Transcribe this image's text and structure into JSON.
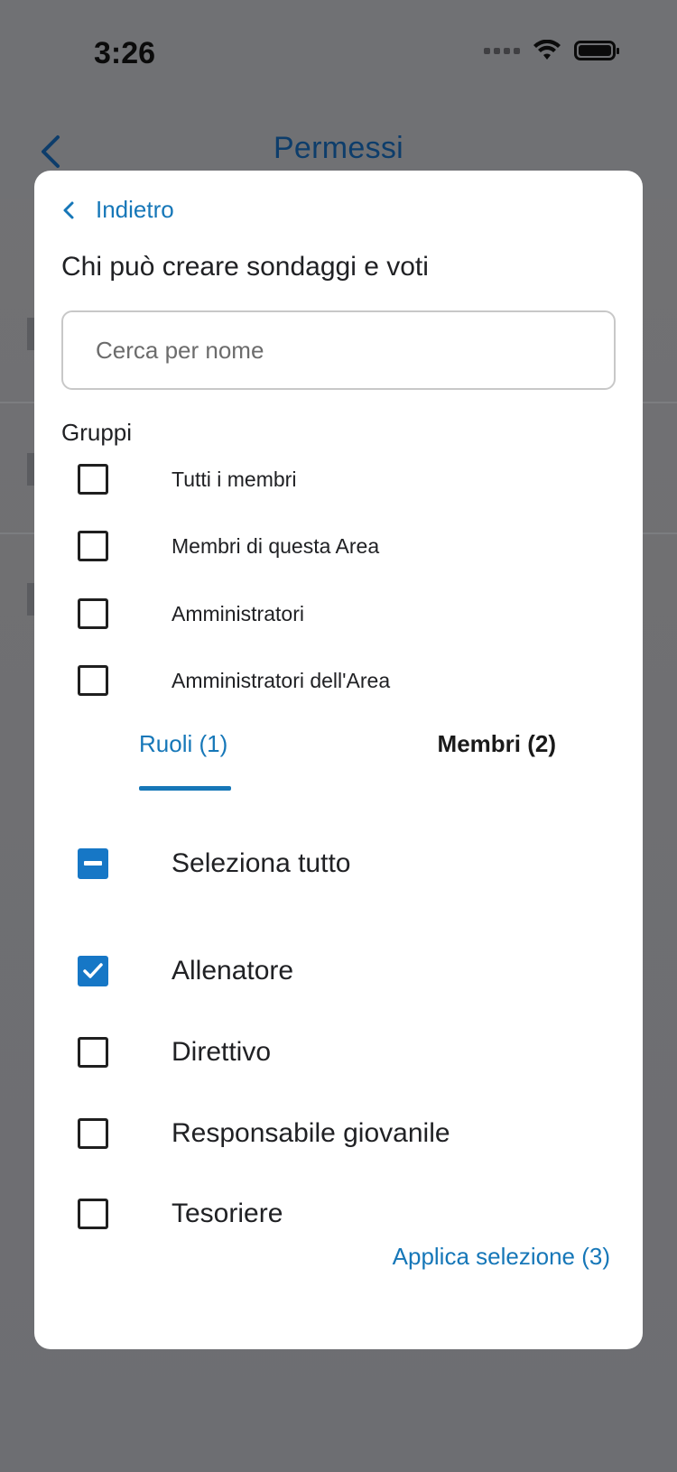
{
  "status_bar": {
    "time": "3:26"
  },
  "background": {
    "nav_title": "Permessi"
  },
  "sheet": {
    "back_label": "Indietro",
    "title": "Chi può creare sondaggi e voti",
    "search_placeholder": "Cerca per nome",
    "groups_header": "Gruppi",
    "groups": [
      {
        "label": "Tutti i membri",
        "checked": false
      },
      {
        "label": "Membri di questa Area",
        "checked": false
      },
      {
        "label": "Amministratori",
        "checked": false
      },
      {
        "label": "Amministratori dell'Area",
        "checked": false
      }
    ],
    "tabs": [
      {
        "label": "Ruoli (1)",
        "active": true
      },
      {
        "label": "Membri (2)",
        "active": false
      }
    ],
    "select_all_label": "Seleziona tutto",
    "roles": [
      {
        "label": "Allenatore",
        "checked": true
      },
      {
        "label": "Direttivo",
        "checked": false
      },
      {
        "label": "Responsabile giovanile",
        "checked": false
      },
      {
        "label": "Tesoriere",
        "checked": false
      }
    ],
    "apply_label": "Applica selezione (3)"
  },
  "colors": {
    "accent": "#1677b8",
    "checkbox_fill": "#1677c6",
    "overlay": "#6f7073"
  }
}
